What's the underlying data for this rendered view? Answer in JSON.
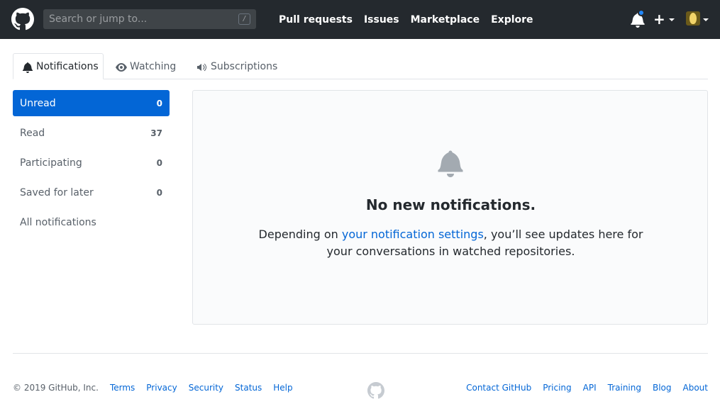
{
  "header": {
    "search_placeholder": "Search or jump to...",
    "search_shortcut": "/",
    "nav": [
      "Pull requests",
      "Issues",
      "Marketplace",
      "Explore"
    ],
    "plus_label": "+"
  },
  "tabs": [
    {
      "label": "Notifications",
      "icon": "bell-icon",
      "selected": true
    },
    {
      "label": "Watching",
      "icon": "eye-icon",
      "selected": false
    },
    {
      "label": "Subscriptions",
      "icon": "broadcast-icon",
      "selected": false
    }
  ],
  "sidebar": {
    "items": [
      {
        "label": "Unread",
        "count": "0",
        "active": true
      },
      {
        "label": "Read",
        "count": "37",
        "active": false
      },
      {
        "label": "Participating",
        "count": "0",
        "active": false
      },
      {
        "label": "Saved for later",
        "count": "0",
        "active": false
      },
      {
        "label": "All notifications",
        "count": "",
        "active": false
      }
    ]
  },
  "blankslate": {
    "title": "No new notifications.",
    "desc_before": "Depending on ",
    "desc_link": "your notification settings",
    "desc_after": ", you’ll see updates here for your conversations in watched repositories."
  },
  "footer": {
    "copyright": "© 2019 GitHub, Inc.",
    "left_links": [
      "Terms",
      "Privacy",
      "Security",
      "Status",
      "Help"
    ],
    "right_links": [
      "Contact GitHub",
      "Pricing",
      "API",
      "Training",
      "Blog",
      "About"
    ]
  },
  "colors": {
    "header_bg": "#24292e",
    "accent": "#0366d6",
    "unread_dot": "#2188ff",
    "muted_text": "#586069",
    "blankslate_bg": "#fafbfc"
  }
}
